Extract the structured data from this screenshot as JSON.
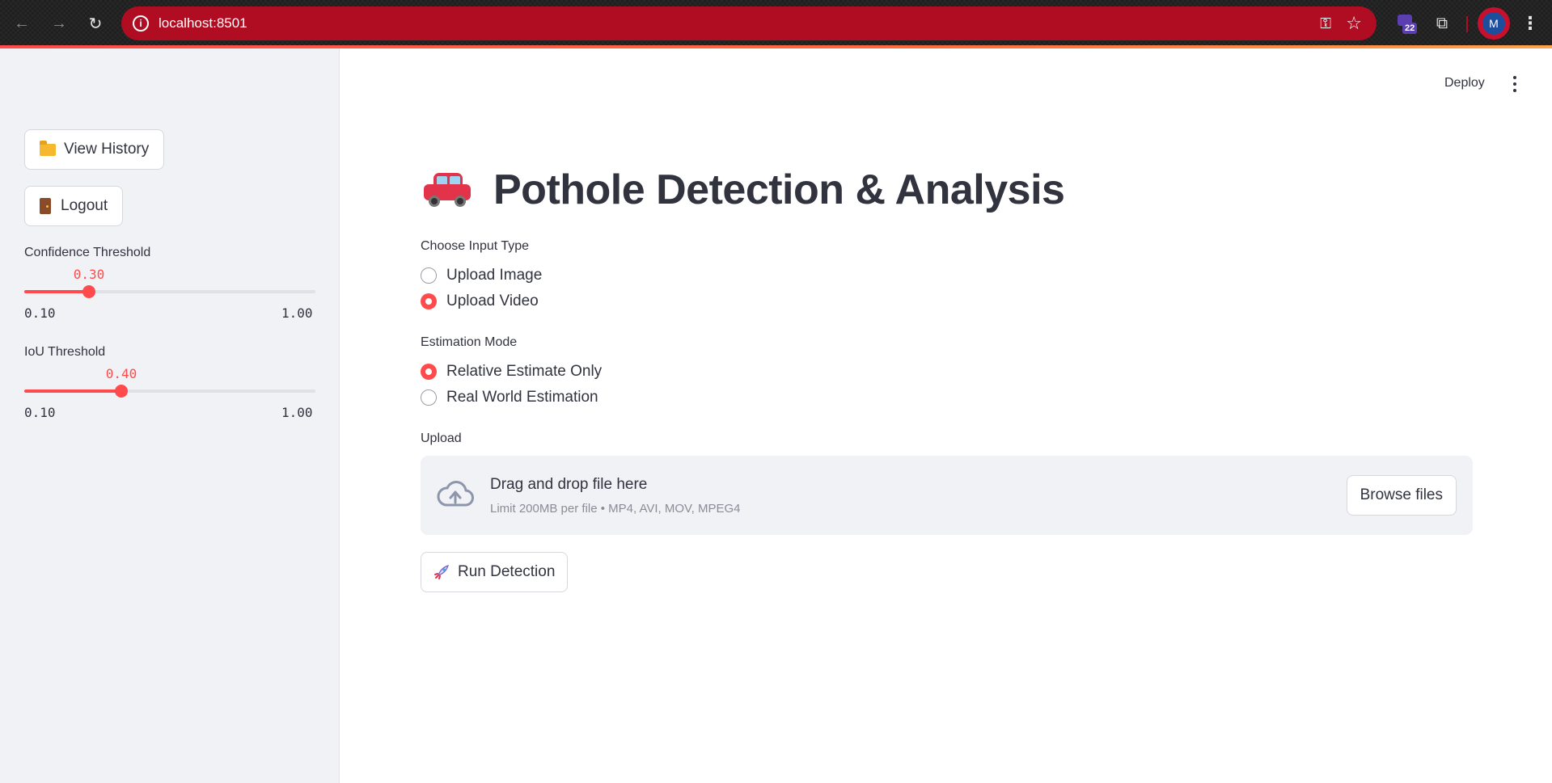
{
  "browser": {
    "url": "localhost:8501",
    "extension_badge_count": "22",
    "profile_initial": "M",
    "accent_color": "#b00d22"
  },
  "toolbar": {
    "deploy_label": "Deploy"
  },
  "sidebar": {
    "view_history_label": "View History",
    "logout_label": "Logout",
    "confidence": {
      "label": "Confidence Threshold",
      "value": "0.30",
      "min": "0.10",
      "max": "1.00",
      "fraction": 0.2222
    },
    "iou": {
      "label": "IoU Threshold",
      "value": "0.40",
      "min": "0.10",
      "max": "1.00",
      "fraction": 0.3333
    }
  },
  "main": {
    "title": "Pothole Detection & Analysis",
    "input_type": {
      "label": "Choose Input Type",
      "options": [
        "Upload Image",
        "Upload Video"
      ],
      "selected": "Upload Video"
    },
    "estimation_mode": {
      "label": "Estimation Mode",
      "options": [
        "Relative Estimate Only",
        "Real World Estimation"
      ],
      "selected": "Relative Estimate Only"
    },
    "upload": {
      "label": "Upload",
      "dropzone_title": "Drag and drop file here",
      "dropzone_hint": "Limit 200MB per file • MP4, AVI, MOV, MPEG4",
      "browse_label": "Browse files"
    },
    "run_label": "Run Detection"
  },
  "colors": {
    "primary": "#ff4b4b",
    "sidebar_bg": "#f0f2f6",
    "text": "#31333f"
  },
  "icons": [
    "back-arrow-icon",
    "forward-arrow-icon",
    "reload-icon",
    "site-info-icon",
    "key-icon",
    "star-icon",
    "extension-icon",
    "puzzle-icon",
    "kebab-menu-icon",
    "folder-icon",
    "door-icon",
    "car-icon",
    "cloud-upload-icon",
    "rocket-icon"
  ]
}
